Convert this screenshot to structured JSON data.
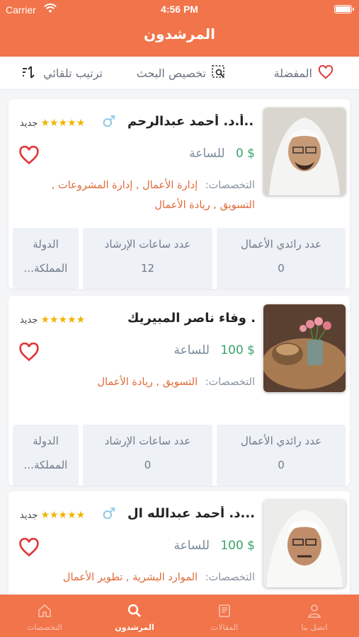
{
  "status_bar": {
    "carrier": "Carrier",
    "time": "4:56 PM"
  },
  "header": {
    "title": "المرشدون"
  },
  "toolbar": {
    "favorites": "المفضلة",
    "customize_search": "تخصيص البحث",
    "sort": "ترتيب تلقائي"
  },
  "labels": {
    "per_hour": "للساعة",
    "specialties": "التخصصات:",
    "new_badge": "جديد",
    "stars": "★★★★★",
    "stat_entrepreneurs": "عدد رائدي الأعمال",
    "stat_hours": "عدد ساعات الإرشاد",
    "stat_country": "الدولة"
  },
  "mentors": [
    {
      "name": "أ.د. أحمد عبدالرحم...",
      "price": "$ 0",
      "specialties": "إدارة الأعمال , إدارة المشروعات , التسويق , ريادة الأعمال",
      "entrepreneurs": "0",
      "hours": "12",
      "country": "المملكة...",
      "gender_icon": "male-icon"
    },
    {
      "name": "أ.د. وفاء ناصر المبيريك",
      "price": "$ 100",
      "specialties": "التسويق , ريادة الأعمال",
      "entrepreneurs": "0",
      "hours": "0",
      "country": "المملكة..."
    },
    {
      "name": "د. أحمد عبدالله ال...",
      "price": "$ 100",
      "specialties": "الموارد البشرية , تطوير الأعمال",
      "gender_icon": "male-icon"
    }
  ],
  "tabbar": {
    "specialties": "التخصصات",
    "mentors": "المرشدون",
    "articles": "المقالات",
    "contact": "اتصل بنا",
    "active": "mentors"
  },
  "colors": {
    "brand": "#f2744a",
    "price_green": "#3aa46a",
    "heart_red": "#e03a3a",
    "star_gold": "#f0b400"
  }
}
